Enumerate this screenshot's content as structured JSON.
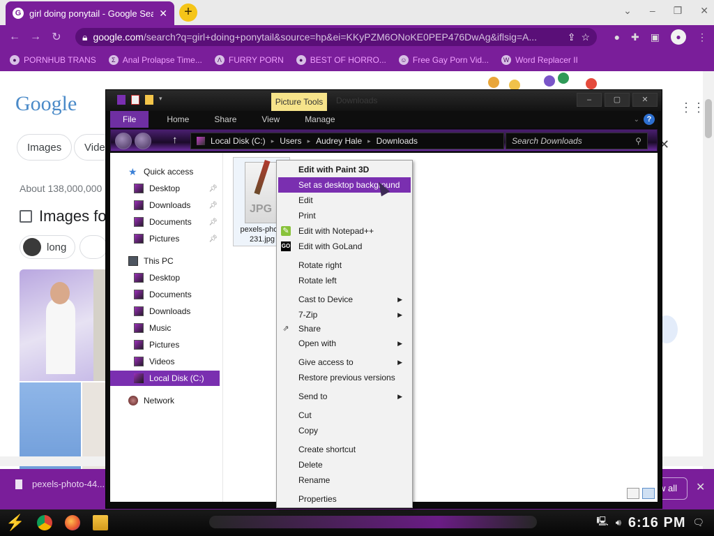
{
  "browser": {
    "tab": {
      "title": "girl doing ponytail - Google Search",
      "icon": "google-g-icon"
    },
    "new_tab_label": "+",
    "window_controls": {
      "chevron": "⌄",
      "minimize": "–",
      "restore": "❐",
      "close": "✕"
    },
    "address": {
      "domain": "google.com",
      "path": "/search?q=girl+doing+ponytail&source=hp&ei=KKyPZM6ONoKE0PEP476DwAg&iflsig=A..."
    },
    "bookmarks": [
      {
        "label": "PORNHUB TRANS",
        "icon": "circle-logo-icon"
      },
      {
        "label": "Anal Prolapse Time...",
        "icon": "bracket-logo-icon"
      },
      {
        "label": "FURRY PORN",
        "icon": "lambda-logo-icon"
      },
      {
        "label": "BEST OF HORRO...",
        "icon": "circle-logo-icon"
      },
      {
        "label": "Free Gay Porn Vid...",
        "icon": "mascot-icon"
      },
      {
        "label": "Word Replacer II",
        "icon": "wr-logo-icon"
      }
    ],
    "colors": {
      "theme": "#7a1e9a",
      "bookmark_text": "#f0a0ff"
    }
  },
  "google_page": {
    "logo": "Google",
    "chips": [
      "Images",
      "Vide"
    ],
    "about": "About 138,000,000",
    "images_heading": "Images fo",
    "pill_label": "long"
  },
  "download_bar": {
    "file": "pexels-photo-44...",
    "show_all": "w all"
  },
  "explorer": {
    "picture_tools": "Picture Tools",
    "title": "Downloads",
    "window_buttons": [
      "–",
      "▢",
      "✕"
    ],
    "ribbon_tabs": [
      "File",
      "Home",
      "Share",
      "View",
      "Manage"
    ],
    "path": [
      "Local Disk (C:)",
      "Users",
      "Audrey Hale",
      "Downloads"
    ],
    "search_placeholder": "Search Downloads",
    "nav": {
      "quick_access": "Quick access",
      "quick_items": [
        "Desktop",
        "Downloads",
        "Documents",
        "Pictures"
      ],
      "this_pc": "This PC",
      "pc_items": [
        "Desktop",
        "Documents",
        "Downloads",
        "Music",
        "Pictures",
        "Videos"
      ],
      "selected": "Local Disk (C:)",
      "network": "Network"
    },
    "file": {
      "name_line1": "pexels-photo",
      "name_line2": "231.jpg",
      "type_label": "JPG"
    }
  },
  "context_menu": {
    "items": [
      {
        "label": "Edit with Paint 3D",
        "bold": true
      },
      {
        "label": "Set as desktop background",
        "highlighted": true
      },
      {
        "label": "Edit"
      },
      {
        "label": "Print"
      },
      {
        "label": "Edit with Notepad++",
        "icon": "notepadpp-icon"
      },
      {
        "label": "Edit with GoLand",
        "icon": "goland-icon"
      },
      {
        "label": "Rotate right"
      },
      {
        "label": "Rotate left"
      },
      {
        "label": "Cast to Device",
        "submenu": true
      },
      {
        "label": "7-Zip",
        "submenu": true
      },
      {
        "label": "Share",
        "icon": "share-icon"
      },
      {
        "label": "Open with",
        "submenu": true
      },
      {
        "label": "Give access to",
        "submenu": true
      },
      {
        "label": "Restore previous versions"
      },
      {
        "label": "Send to",
        "submenu": true
      },
      {
        "label": "Cut"
      },
      {
        "label": "Copy"
      },
      {
        "label": "Create shortcut"
      },
      {
        "label": "Delete"
      },
      {
        "label": "Rename"
      },
      {
        "label": "Properties"
      }
    ],
    "highlight_color": "#7a2fb0"
  },
  "taskbar": {
    "clock": "6:16 PM",
    "apps": [
      "chrome-icon",
      "firefox-icon",
      "file-explorer-icon"
    ]
  }
}
